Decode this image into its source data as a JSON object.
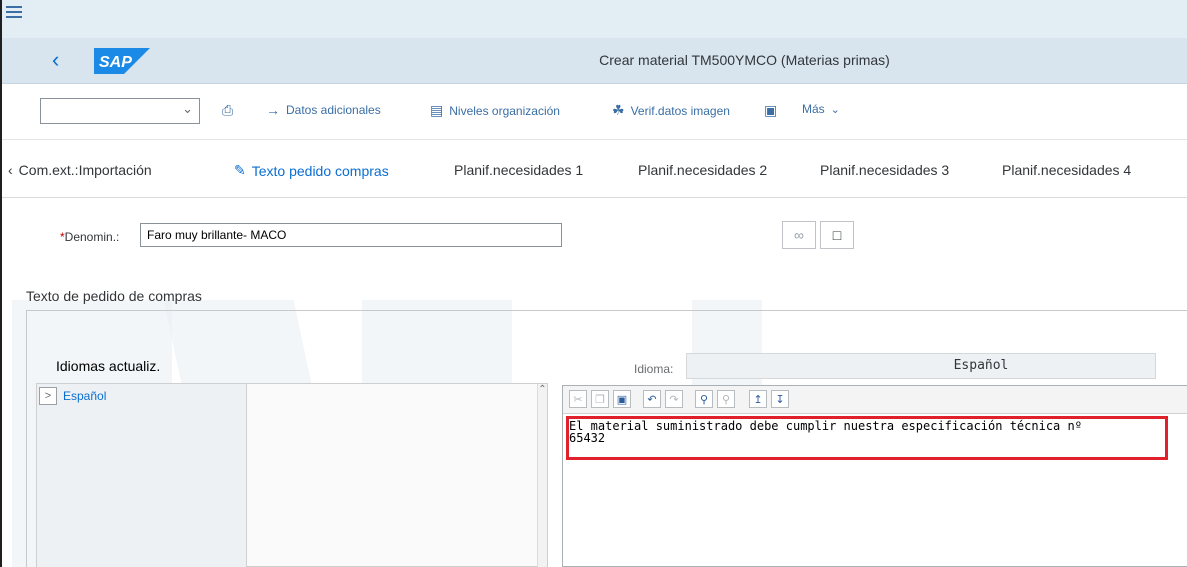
{
  "shell": {
    "title": "Crear material TM500YMCO (Materias primas)",
    "logo_text": "SAP"
  },
  "toolbar": {
    "select_value": "",
    "items": [
      {
        "label": "Datos adicionales",
        "icon": "arrow-right-icon"
      },
      {
        "label": "Niveles organización",
        "icon": "org-levels-icon"
      },
      {
        "label": "Verif.datos imagen",
        "icon": "check-image-icon"
      },
      {
        "label": "",
        "icon": "lock-icon"
      },
      {
        "label": "Más",
        "icon": "chevron-down-icon"
      }
    ]
  },
  "tabs": {
    "items": [
      {
        "label": "Com.ext.:Importación",
        "active": false
      },
      {
        "label": "Texto pedido compras",
        "active": true
      },
      {
        "label": "Planif.necesidades 1",
        "active": false
      },
      {
        "label": "Planif.necesidades 2",
        "active": false
      },
      {
        "label": "Planif.necesidades 3",
        "active": false
      },
      {
        "label": "Planif.necesidades 4",
        "active": false
      }
    ]
  },
  "form": {
    "required_marker": "*",
    "denomin_label": "Denomin.:",
    "denomin_value": "Faro muy brillante- MACO"
  },
  "purchase_text": {
    "section_title": "Texto de pedido de compras",
    "languages_label": "Idiomas actualiz.",
    "languages": [
      "Español"
    ],
    "language_field_label": "Idioma:",
    "language_field_value": "Español",
    "text_line1": "El material suministrado debe cumplir nuestra especificación técnica nº",
    "text_line2": "65432"
  },
  "colors": {
    "accent": "#0a6ed1",
    "highlight": "#e0202a",
    "shell_bg": "#d8e5ee"
  }
}
